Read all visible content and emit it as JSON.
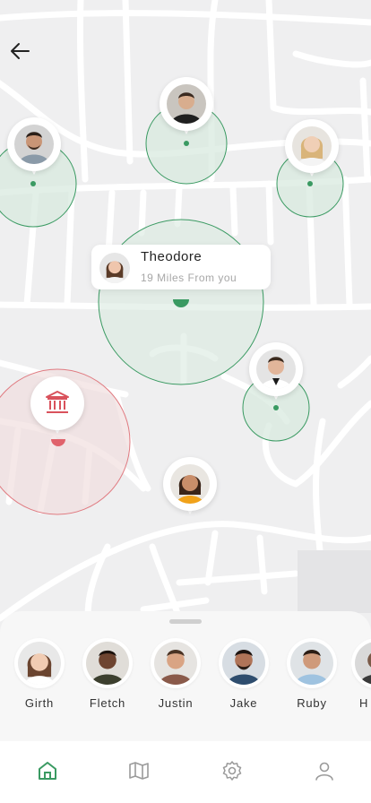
{
  "selected_person": {
    "name": "Theodore",
    "distance": "19 Miles From you"
  },
  "friends": [
    {
      "name": "Girth"
    },
    {
      "name": "Fletch"
    },
    {
      "name": "Justin"
    },
    {
      "name": "Jake"
    },
    {
      "name": "Ruby"
    },
    {
      "name": "H"
    }
  ],
  "nav": {
    "active": "home",
    "items": [
      "home-icon",
      "map-icon",
      "settings-icon",
      "profile-icon"
    ]
  },
  "colors": {
    "accent": "#3a9a62",
    "zone_green": "#cfe6d6",
    "zone_red": "#e07a80",
    "inactive_icon": "#9a9a9a"
  }
}
